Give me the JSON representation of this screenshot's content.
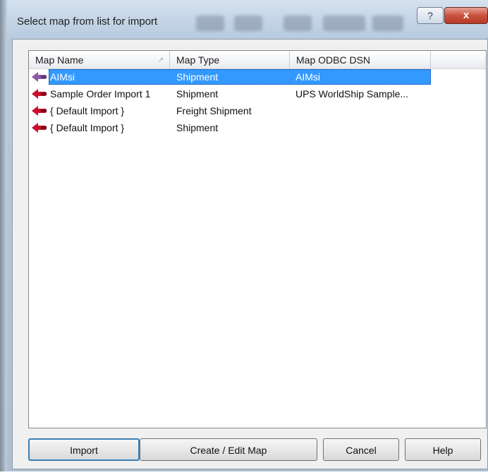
{
  "window": {
    "title": "Select map from list for import",
    "help_glyph": "?",
    "close_glyph": "x"
  },
  "list": {
    "columns": [
      {
        "label": "Map Name",
        "sort_indicator": "^"
      },
      {
        "label": "Map Type"
      },
      {
        "label": "Map ODBC DSN"
      }
    ],
    "rows": [
      {
        "name": "AIMsi",
        "type": "Shipment",
        "dsn": "AIMsi",
        "selected": true,
        "icon": "map-arrow-icon"
      },
      {
        "name": "Sample Order Import 1",
        "type": "Shipment",
        "dsn": "UPS WorldShip Sample...",
        "selected": false,
        "icon": "map-arrow-icon"
      },
      {
        "name": "{ Default Import }",
        "type": "Freight Shipment",
        "dsn": "",
        "selected": false,
        "icon": "map-arrow-icon"
      },
      {
        "name": "{ Default Import }",
        "type": "Shipment",
        "dsn": "",
        "selected": false,
        "icon": "map-arrow-icon"
      }
    ]
  },
  "buttons": {
    "import": "Import",
    "create_edit": "Create / Edit Map",
    "cancel": "Cancel",
    "help": "Help"
  },
  "colors": {
    "selection": "#3399ff",
    "icon_red": "#c8102e",
    "icon_selected": "#8e5aa8"
  }
}
